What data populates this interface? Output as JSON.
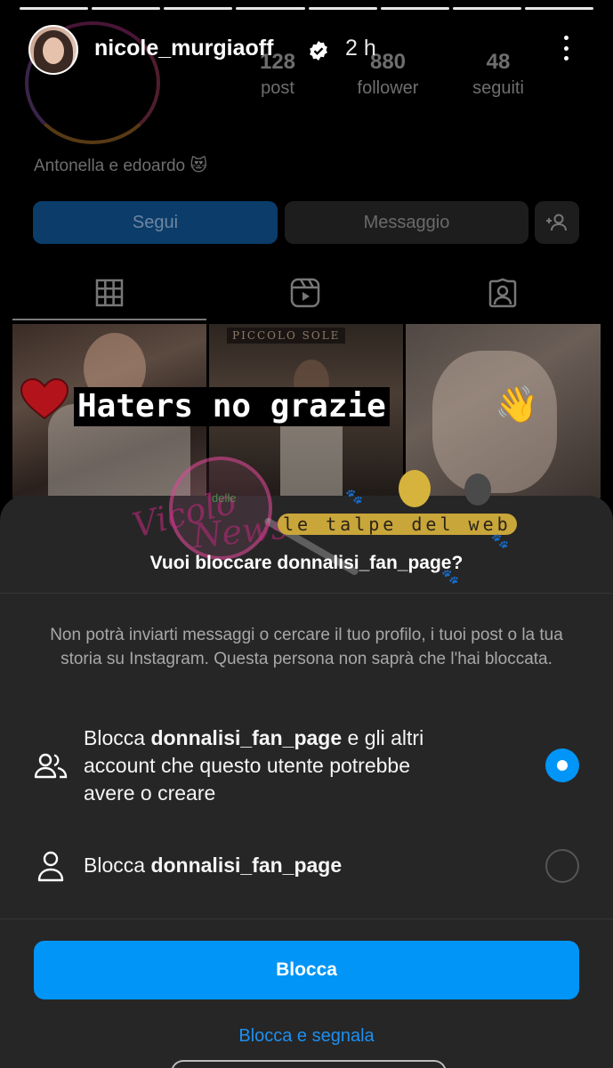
{
  "story": {
    "username": "nicole_murgiaoff",
    "time": "2 h",
    "caption": "Haters no grazie",
    "caption_emoji": "👋"
  },
  "underlay": {
    "stats": [
      {
        "number": "128",
        "label": "post"
      },
      {
        "number": "880",
        "label": "follower"
      },
      {
        "number": "48",
        "label": "seguiti"
      }
    ],
    "bio": "Antonella e edoardo 😻",
    "follow_label": "Segui",
    "message_label": "Messaggio",
    "grid_label": "PICCOLO SOLE"
  },
  "sheet": {
    "title": "Vuoi bloccare donnalisi_fan_page?",
    "description": "Non potrà inviarti messaggi o cercare il tuo profilo, i tuoi post o la tua storia su Instagram. Questa persona non saprà che l'hai bloccata.",
    "option1": {
      "prefix": "Blocca ",
      "account": "donnalisi_fan_page",
      "line1_suffix": " e gli altri",
      "line2": "account che questo utente potrebbe",
      "line3": "avere o creare",
      "selected": true
    },
    "option2": {
      "prefix": "Blocca ",
      "account": "donnalisi_fan_page",
      "selected": false
    },
    "block_button": "Blocca",
    "block_report_link": "Blocca e segnala"
  },
  "watermarks": {
    "vicolo_1": "Vicolo",
    "vicolo_2": "delle",
    "vicolo_3": "News",
    "talpe": "le talpe del web"
  },
  "colors": {
    "accent": "#0095f6",
    "sheet_bg": "#262626",
    "link": "#1d8ff0"
  },
  "icons": {
    "verified": "verified-badge-icon",
    "more": "more-vertical-icon",
    "group": "people-icon",
    "person": "person-icon"
  }
}
